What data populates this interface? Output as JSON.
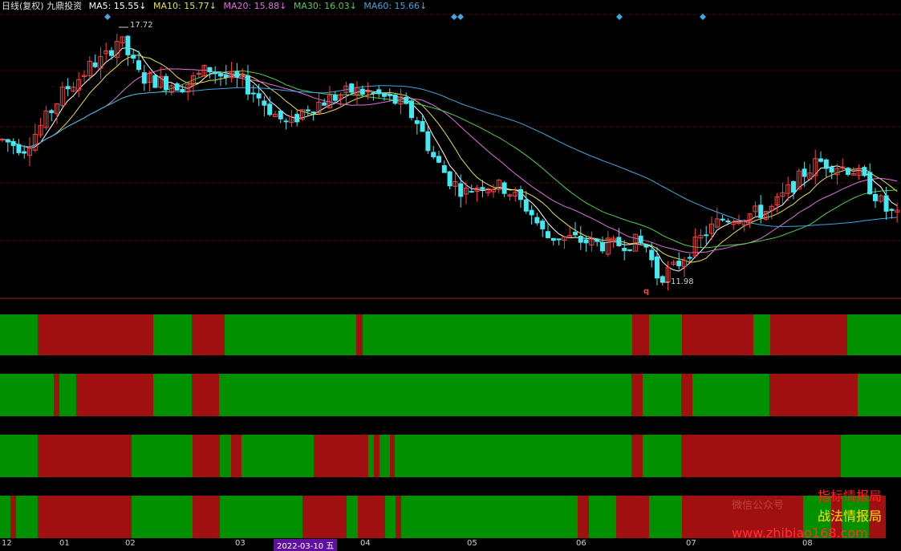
{
  "header": {
    "title": "日线(复权) 九鼎投资",
    "indicators": [
      {
        "label": "MA5: 15.55↓",
        "color": "#ffffff"
      },
      {
        "label": "MA10: 15.77↓",
        "color": "#e8e04a"
      },
      {
        "label": "MA20: 15.88↓",
        "color": "#e070e0"
      },
      {
        "label": "MA30: 16.03↓",
        "color": "#50d050"
      },
      {
        "label": "MA60: 15.66↓",
        "color": "#40a8e0"
      }
    ]
  },
  "annotations": {
    "high_price": "17.72",
    "low_price": "11.98",
    "marker_q": "q"
  },
  "time_axis": {
    "labels": [
      "12",
      "01",
      "02",
      "03",
      "2022-03-10 五",
      "04",
      "05",
      "06",
      "07",
      "08"
    ]
  },
  "colors": {
    "up": "#ff4040",
    "down": "#44e8f0",
    "band_green": "#009000",
    "band_red": "#a01010"
  },
  "watermark": {
    "line1": "指标情报局",
    "line2": "战法情报局",
    "wechat": "微信公众号",
    "url": "www.zhibiao168.com"
  },
  "chart_data": {
    "type": "candlestick",
    "high": 17.72,
    "low": 11.98,
    "bands": [
      {
        "segments": [
          [
            "G",
            47
          ],
          [
            "R",
            144
          ],
          [
            "G",
            48
          ],
          [
            "R",
            41
          ],
          [
            "G",
            164
          ],
          [
            "R",
            8
          ],
          [
            "G",
            336
          ],
          [
            "R",
            21
          ],
          [
            "G",
            41
          ],
          [
            "R",
            89
          ],
          [
            "G",
            21
          ],
          [
            "R",
            96
          ],
          [
            "G",
            67
          ]
        ]
      },
      {
        "segments": [
          [
            "G",
            67
          ],
          [
            "R",
            7
          ],
          [
            "G",
            21
          ],
          [
            "R",
            96
          ],
          [
            "G",
            48
          ],
          [
            "R",
            34
          ],
          [
            "G",
            514
          ],
          [
            "R",
            14
          ],
          [
            "G",
            48
          ],
          [
            "R",
            14
          ],
          [
            "G",
            96
          ],
          [
            "R",
            110
          ],
          [
            "G",
            54
          ]
        ]
      },
      {
        "segments": [
          [
            "G",
            47
          ],
          [
            "R",
            117
          ],
          [
            "G",
            76
          ],
          [
            "R",
            34
          ],
          [
            "G",
            14
          ],
          [
            "R",
            13
          ],
          [
            "G",
            90
          ],
          [
            "R",
            68
          ],
          [
            "G",
            7
          ],
          [
            "R",
            7
          ],
          [
            "G",
            13
          ],
          [
            "R",
            6
          ],
          [
            "G",
            295
          ],
          [
            "R",
            14
          ],
          [
            "G",
            48
          ],
          [
            "R",
            199
          ],
          [
            "G",
            75
          ]
        ]
      },
      {
        "segments": [
          [
            "G",
            13
          ],
          [
            "R",
            7
          ],
          [
            "G",
            27
          ],
          [
            "R",
            117
          ],
          [
            "G",
            76
          ],
          [
            "R",
            34
          ],
          [
            "G",
            103
          ],
          [
            "R",
            55
          ],
          [
            "G",
            14
          ],
          [
            "R",
            34
          ],
          [
            "G",
            13
          ],
          [
            "R",
            7
          ],
          [
            "G",
            220
          ],
          [
            "R",
            14
          ],
          [
            "G",
            34
          ],
          [
            "R",
            41
          ],
          [
            "G",
            41
          ],
          [
            "R",
            151
          ],
          [
            "G",
            35
          ],
          [
            "R",
            13
          ],
          [
            "G",
            34
          ],
          [
            "R",
            21
          ]
        ]
      }
    ]
  }
}
